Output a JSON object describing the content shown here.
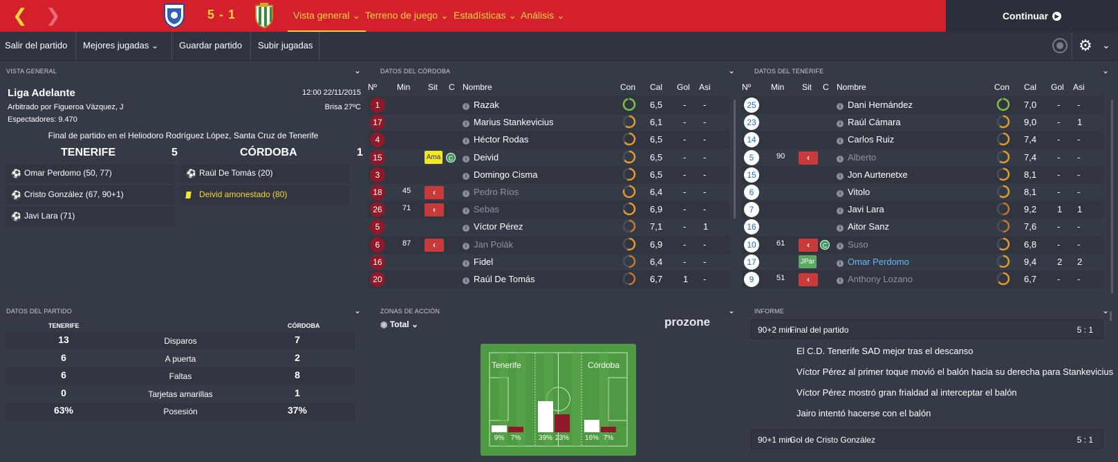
{
  "header": {
    "score": "5 - 1",
    "nav": [
      "Vista general",
      "Terreno de juego",
      "Estadísticas",
      "Análisis"
    ],
    "continue_label": "Continuar"
  },
  "toolbar": {
    "exit": "Salir del partido",
    "best": "Mejores jugadas",
    "save": "Guardar partido",
    "upload": "Subir jugadas"
  },
  "overview": {
    "heading": "VISTA GENERAL",
    "league": "Liga Adelante",
    "datetime": "12:00 22/11/2015",
    "referee": "Arbitrado por Figueroa Vázquez, J",
    "weather": "Brisa 27ºC",
    "attendance": "Espectadores: 9.470",
    "final": "Final de partido en el Heliodoro Rodríguez López, Santa Cruz de Tenerife",
    "home": {
      "name": "TENERIFE",
      "goals": "5",
      "events": [
        "Omar Perdomo (50, 77)",
        "Cristo González (67, 90+1)",
        "Javi Lara (71)"
      ]
    },
    "away": {
      "name": "CÓRDOBA",
      "goals": "1",
      "events": [
        "Raúl De Tomás (20)",
        "Deivid amonestado (80)"
      ]
    }
  },
  "cordoba": {
    "heading": "DATOS DEL CÓRDOBA",
    "cols": [
      "Nº",
      "Min",
      "Sit",
      "C",
      "Nombre",
      "Con",
      "Cal",
      "Gol",
      "Asi"
    ],
    "players": [
      {
        "n": "1",
        "min": "",
        "sit": "",
        "c": "",
        "name": "Razak",
        "cond": 0.95,
        "cal": "6,5",
        "gol": "-",
        "asi": "-",
        "out": false
      },
      {
        "n": "17",
        "min": "",
        "sit": "",
        "c": "",
        "name": "Marius Stankevicius",
        "cond": 0.6,
        "cal": "6,1",
        "gol": "-",
        "asi": "-",
        "out": false
      },
      {
        "n": "4",
        "min": "",
        "sit": "",
        "c": "",
        "name": "Héctor Rodas",
        "cond": 0.65,
        "cal": "6,5",
        "gol": "-",
        "asi": "-",
        "out": false
      },
      {
        "n": "15",
        "min": "",
        "sit": "Ama",
        "c": "C",
        "name": "Deivid",
        "cond": 0.65,
        "cal": "6,5",
        "gol": "-",
        "asi": "-",
        "out": false
      },
      {
        "n": "3",
        "min": "",
        "sit": "",
        "c": "",
        "name": "Domingo Cisma",
        "cond": 0.55,
        "cal": "6,5",
        "gol": "-",
        "asi": "-",
        "out": false
      },
      {
        "n": "18",
        "min": "45",
        "sit": "sub",
        "c": "",
        "name": "Pedro Ríos",
        "cond": 0.8,
        "cal": "6,4",
        "gol": "-",
        "asi": "-",
        "out": true
      },
      {
        "n": "26",
        "min": "71",
        "sit": "sub",
        "c": "",
        "name": "Sebas",
        "cond": 0.7,
        "cal": "6,9",
        "gol": "-",
        "asi": "-",
        "out": true
      },
      {
        "n": "5",
        "min": "",
        "sit": "",
        "c": "",
        "name": "Víctor Pérez",
        "cond": 0.45,
        "cal": "7,1",
        "gol": "-",
        "asi": "1",
        "out": false
      },
      {
        "n": "6",
        "min": "87",
        "sit": "sub",
        "c": "",
        "name": "Jan Polák",
        "cond": 0.55,
        "cal": "6,9",
        "gol": "-",
        "asi": "-",
        "out": true
      },
      {
        "n": "16",
        "min": "",
        "sit": "",
        "c": "",
        "name": "Fidel",
        "cond": 0.5,
        "cal": "6,4",
        "gol": "-",
        "asi": "-",
        "out": false
      },
      {
        "n": "20",
        "min": "",
        "sit": "",
        "c": "",
        "name": "Raúl De Tomás",
        "cond": 0.5,
        "cal": "6,7",
        "gol": "1",
        "asi": "-",
        "out": false
      }
    ]
  },
  "tenerife": {
    "heading": "DATOS DEL TENERIFE",
    "cols": [
      "Nº",
      "Min",
      "Sit",
      "C",
      "Nombre",
      "Con",
      "Cal",
      "Gol",
      "Asi"
    ],
    "players": [
      {
        "n": "25",
        "min": "",
        "sit": "",
        "c": "",
        "name": "Dani Hernández",
        "cond": 0.95,
        "cal": "7,0",
        "gol": "-",
        "asi": "-",
        "out": false,
        "hl": false
      },
      {
        "n": "23",
        "min": "",
        "sit": "",
        "c": "",
        "name": "Raúl Cámara",
        "cond": 0.6,
        "cal": "9,0",
        "gol": "-",
        "asi": "1",
        "out": false,
        "hl": false
      },
      {
        "n": "14",
        "min": "",
        "sit": "",
        "c": "",
        "name": "Carlos Ruiz",
        "cond": 0.6,
        "cal": "7,4",
        "gol": "-",
        "asi": "-",
        "out": false,
        "hl": false
      },
      {
        "n": "5",
        "min": "90",
        "sit": "sub",
        "c": "",
        "name": "Alberto",
        "cond": 0.6,
        "cal": "7,4",
        "gol": "-",
        "asi": "-",
        "out": true,
        "hl": false
      },
      {
        "n": "15",
        "min": "",
        "sit": "",
        "c": "",
        "name": "Jon Aurtenetxe",
        "cond": 0.6,
        "cal": "8,1",
        "gol": "-",
        "asi": "-",
        "out": false,
        "hl": false
      },
      {
        "n": "6",
        "min": "",
        "sit": "",
        "c": "",
        "name": "Vitolo",
        "cond": 0.6,
        "cal": "8,1",
        "gol": "-",
        "asi": "-",
        "out": false,
        "hl": false
      },
      {
        "n": "7",
        "min": "",
        "sit": "",
        "c": "",
        "name": "Javi Lara",
        "cond": 0.5,
        "cal": "9,2",
        "gol": "1",
        "asi": "1",
        "out": false,
        "hl": false
      },
      {
        "n": "16",
        "min": "",
        "sit": "",
        "c": "",
        "name": "Aitor Sanz",
        "cond": 0.5,
        "cal": "7,6",
        "gol": "-",
        "asi": "-",
        "out": false,
        "hl": false
      },
      {
        "n": "10",
        "min": "61",
        "sit": "sub",
        "c": "C",
        "name": "Suso",
        "cond": 0.6,
        "cal": "6,8",
        "gol": "-",
        "asi": "-",
        "out": true,
        "hl": false
      },
      {
        "n": "17",
        "min": "",
        "sit": "JPar",
        "c": "",
        "name": "Omar Perdomo",
        "cond": 0.6,
        "cal": "9,4",
        "gol": "2",
        "asi": "2",
        "out": false,
        "hl": true
      },
      {
        "n": "9",
        "min": "51",
        "sit": "sub",
        "c": "",
        "name": "Anthony Lozano",
        "cond": 0.65,
        "cal": "6,7",
        "gol": "-",
        "asi": "-",
        "out": true,
        "hl": false
      }
    ]
  },
  "match_stats": {
    "heading": "DATOS DEL PARTIDO",
    "home": "TENERIFE",
    "away": "CÓRDOBA",
    "rows": [
      {
        "label": "Disparos",
        "h": "13",
        "a": "7"
      },
      {
        "label": "A puerta",
        "h": "6",
        "a": "2"
      },
      {
        "label": "Faltas",
        "h": "6",
        "a": "8"
      },
      {
        "label": "Tarjetas amarillas",
        "h": "0",
        "a": "1"
      },
      {
        "label": "Posesión",
        "h": "63%",
        "a": "37%"
      }
    ]
  },
  "zones": {
    "heading": "ZONAS DE ACCIÓN",
    "filter": "Total",
    "brand": "prozone",
    "home": "Tenerife",
    "away": "Córdoba",
    "thirds": [
      {
        "h": 9,
        "a": 7,
        "hl": "9%",
        "al": "7%"
      },
      {
        "h": 39,
        "a": 23,
        "hl": "39%",
        "al": "23%"
      },
      {
        "h": 16,
        "a": 7,
        "hl": "16%",
        "al": "7%"
      }
    ]
  },
  "report": {
    "heading": "INFORME",
    "blocks": [
      {
        "time": "90+2 min.",
        "title": "Final del partido",
        "score": "5 : 1",
        "lines": [
          "El C.D. Tenerife SAD mejor tras el descanso",
          "Víctor Pérez al primer toque movió el balón hacia su derecha para Stankevicius",
          "Víctor Pérez mostró gran frialdad al interceptar el balón",
          "Jairo intentó hacerse con el balón"
        ]
      },
      {
        "time": "90+1 min.",
        "title": "Gol de Cristo González",
        "score": "5 : 1",
        "lines": []
      }
    ]
  },
  "colors": {
    "topbar": "#d41f2d",
    "accent": "#ffd43d",
    "cordoba": "#8e1928",
    "sub": "#c93a3a",
    "ring": "#e39a2b"
  }
}
